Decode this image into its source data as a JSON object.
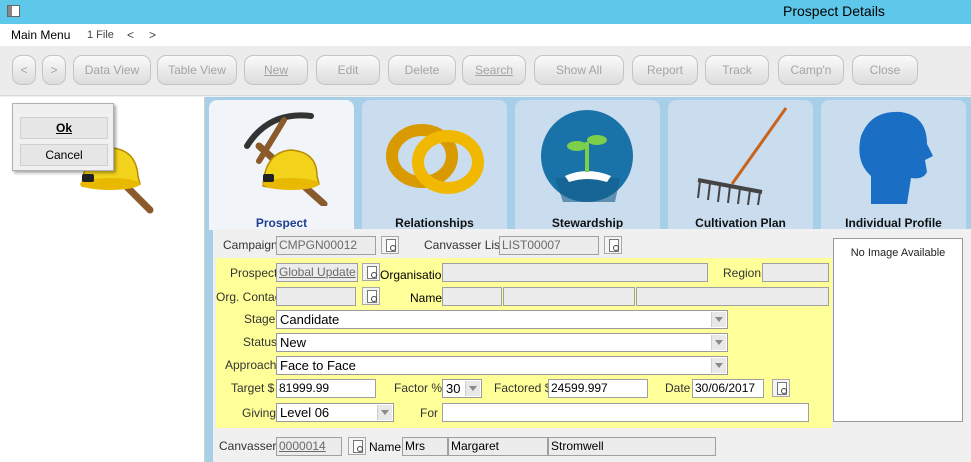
{
  "window": {
    "title": "Prospect Details"
  },
  "menu": {
    "main": "Main Menu",
    "file": "1 File",
    "back": "<",
    "forward": ">"
  },
  "toolbar": {
    "prev": "<",
    "next": ">",
    "data_view": "Data View",
    "table_view": "Table View",
    "new": "New",
    "edit": "Edit",
    "delete": "Delete",
    "search": "Search",
    "show_all": "Show All",
    "report": "Report",
    "track": "Track",
    "campaign": "Camp'n",
    "close": "Close"
  },
  "popup": {
    "ok": "Ok",
    "cancel": "Cancel"
  },
  "tabs": [
    {
      "label": "Prospect"
    },
    {
      "label": "Relationships"
    },
    {
      "label": "Stewardship"
    },
    {
      "label": "Cultivation Plan"
    },
    {
      "label": "Individual Profile"
    }
  ],
  "form": {
    "campaign_label": "Campaign",
    "campaign": "CMPGN00012",
    "canvasser_list_label": "Canvasser List",
    "canvasser_list": "LIST00007",
    "prospect_label": "Prospect",
    "prospect": "Global Update",
    "organisation_label": "Organisation",
    "organisation": "",
    "region_label": "Region",
    "region": "",
    "org_contact_label": "Org. Contact",
    "org_contact": "",
    "name_label": "Name",
    "stage_label": "Stage",
    "stage": "Candidate",
    "status_label": "Status",
    "status": "New",
    "approach_label": "Approach",
    "approach": "Face to Face",
    "target_label": "Target $",
    "target": "81999.99",
    "factor_label": "Factor %",
    "factor": "30",
    "factored_label": "Factored $",
    "factored": "24599.997",
    "date_label": "Date",
    "date": "30/06/2017",
    "giving_label": "Giving",
    "giving": "Level 06",
    "for_label": "For",
    "for": "",
    "canvasser_label": "Canvasser",
    "canvasser": "0000014",
    "canvasser_name_label": "Name",
    "canvasser_title": "Mrs",
    "canvasser_first": "Margaret",
    "canvasser_last": "Stromwell"
  },
  "image_box": {
    "text": "No Image Available"
  }
}
